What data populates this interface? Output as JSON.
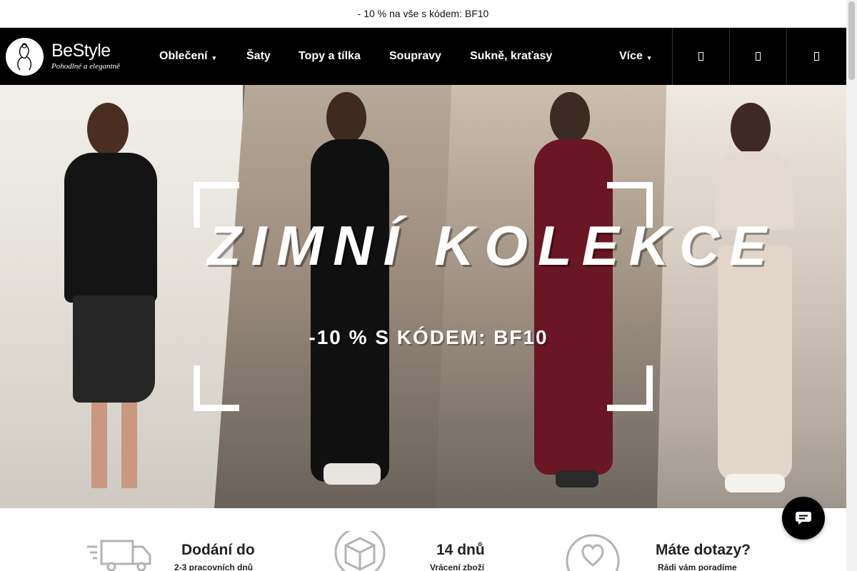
{
  "announcement": {
    "text": "- 10 % na vše s kódem: BF10"
  },
  "brand": {
    "name": "BeStyle",
    "tagline": "Pohodlné a elegantně"
  },
  "nav": {
    "items": [
      {
        "label": "Oblečení",
        "has_dropdown": true
      },
      {
        "label": "Šaty"
      },
      {
        "label": "Topy a tílka"
      },
      {
        "label": "Soupravy"
      },
      {
        "label": "Sukně, kraťasy"
      }
    ],
    "more": {
      "label": "Více",
      "has_dropdown": true
    }
  },
  "header_icons": [
    {
      "icon": "search-icon"
    },
    {
      "icon": "user-icon"
    },
    {
      "icon": "cart-icon"
    }
  ],
  "hero": {
    "title": "ZIMNÍ KOLEKCE",
    "promo": "-10 % S KÓDEM: BF10"
  },
  "features": [
    {
      "icon": "delivery-truck-icon",
      "title": "Dodání do",
      "subtitle": "2-3 pracovních dnů"
    },
    {
      "icon": "return-box-icon",
      "title": "14 dnů",
      "subtitle": "Vrácení zboží"
    },
    {
      "icon": "heart-icon",
      "title": "Máte dotazy?",
      "subtitle": "Rádi vám poradíme"
    }
  ],
  "chat": {
    "icon": "chat-bubble-icon"
  },
  "colors": {
    "header_bg": "#000000",
    "accent": "#ffffff",
    "chat_bg": "#000000"
  }
}
